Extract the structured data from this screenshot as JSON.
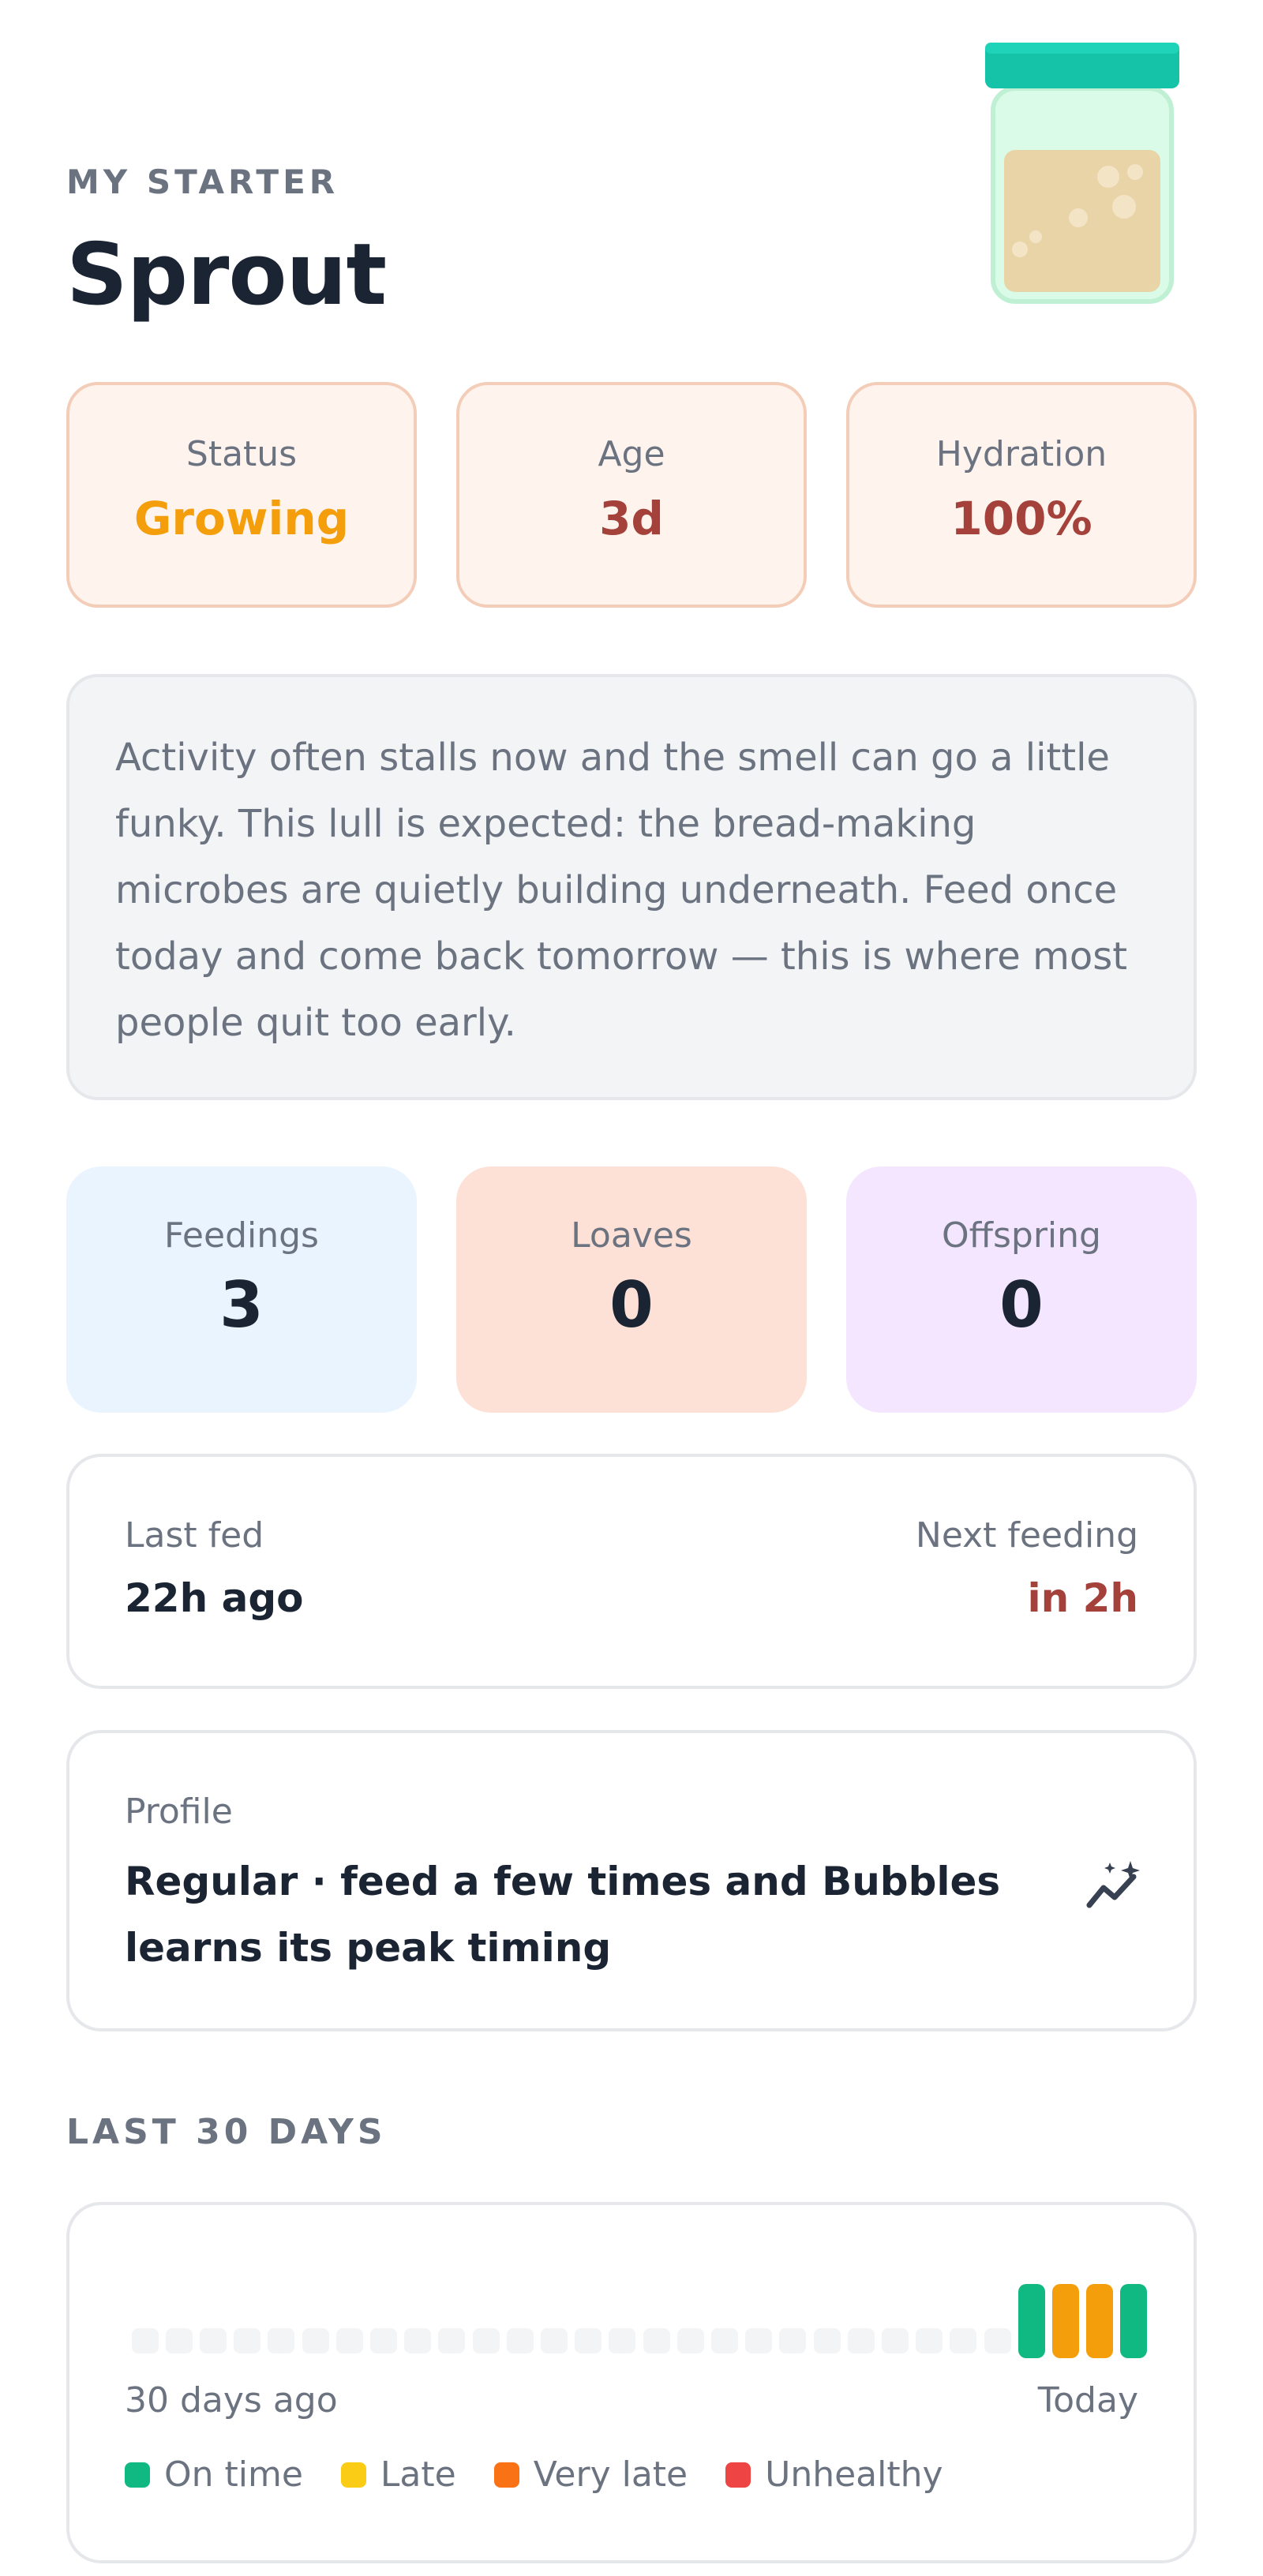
{
  "header": {
    "eyebrow": "MY STARTER",
    "name": "Sprout"
  },
  "status_cards": [
    {
      "label": "Status",
      "value": "Growing",
      "color": "#f59e0b"
    },
    {
      "label": "Age",
      "value": "3d",
      "color": "#a3413a"
    },
    {
      "label": "Hydration",
      "value": "100%",
      "color": "#a3413a"
    }
  ],
  "message": "Activity often stalls now and the smell can go a little funky. This lull is expected: the bread-making microbes are quietly building underneath. Feed once today and come back tomorrow — this is where most people quit too early.",
  "counts": [
    {
      "label": "Feedings",
      "value": "3",
      "bg": "#eaf4ff"
    },
    {
      "label": "Loaves",
      "value": "0",
      "bg": "#fde0d6"
    },
    {
      "label": "Offspring",
      "value": "0",
      "bg": "#f3e6fe"
    }
  ],
  "feeding": {
    "last_label": "Last fed",
    "last_value": "22h ago",
    "next_label": "Next feeding",
    "next_value": "in 2h",
    "next_color": "#a3413a"
  },
  "profile": {
    "label": "Profile",
    "text": "Regular · feed a few times and Bubbles learns its peak timing",
    "icon": "sparkle-chart-icon"
  },
  "history": {
    "title": "LAST 30 DAYS",
    "start_label": "30 days ago",
    "end_label": "Today",
    "days": [
      "none",
      "none",
      "none",
      "none",
      "none",
      "none",
      "none",
      "none",
      "none",
      "none",
      "none",
      "none",
      "none",
      "none",
      "none",
      "none",
      "none",
      "none",
      "none",
      "none",
      "none",
      "none",
      "none",
      "none",
      "none",
      "none",
      "on_time",
      "late",
      "late",
      "on_time"
    ],
    "legend": [
      {
        "key": "on_time",
        "label": "On time",
        "color": "#10b981"
      },
      {
        "key": "late",
        "label": "Late",
        "color": "#facc15"
      },
      {
        "key": "very_late",
        "label": "Very late",
        "color": "#f97316"
      },
      {
        "key": "unhealthy",
        "label": "Unhealthy",
        "color": "#ef4444"
      }
    ],
    "colors": {
      "none": "#f3f4f6",
      "on_time": "#10b981",
      "late": "#f59e0b"
    }
  }
}
